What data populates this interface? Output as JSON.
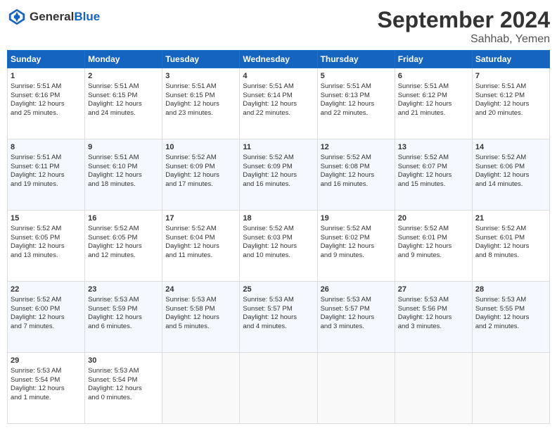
{
  "header": {
    "logo_text_general": "General",
    "logo_text_blue": "Blue",
    "month_title": "September 2024",
    "location": "Sahhab, Yemen"
  },
  "weekdays": [
    "Sunday",
    "Monday",
    "Tuesday",
    "Wednesday",
    "Thursday",
    "Friday",
    "Saturday"
  ],
  "weeks": [
    [
      {
        "day": "1",
        "lines": [
          "Sunrise: 5:51 AM",
          "Sunset: 6:16 PM",
          "Daylight: 12 hours",
          "and 25 minutes."
        ]
      },
      {
        "day": "2",
        "lines": [
          "Sunrise: 5:51 AM",
          "Sunset: 6:15 PM",
          "Daylight: 12 hours",
          "and 24 minutes."
        ]
      },
      {
        "day": "3",
        "lines": [
          "Sunrise: 5:51 AM",
          "Sunset: 6:15 PM",
          "Daylight: 12 hours",
          "and 23 minutes."
        ]
      },
      {
        "day": "4",
        "lines": [
          "Sunrise: 5:51 AM",
          "Sunset: 6:14 PM",
          "Daylight: 12 hours",
          "and 22 minutes."
        ]
      },
      {
        "day": "5",
        "lines": [
          "Sunrise: 5:51 AM",
          "Sunset: 6:13 PM",
          "Daylight: 12 hours",
          "and 22 minutes."
        ]
      },
      {
        "day": "6",
        "lines": [
          "Sunrise: 5:51 AM",
          "Sunset: 6:12 PM",
          "Daylight: 12 hours",
          "and 21 minutes."
        ]
      },
      {
        "day": "7",
        "lines": [
          "Sunrise: 5:51 AM",
          "Sunset: 6:12 PM",
          "Daylight: 12 hours",
          "and 20 minutes."
        ]
      }
    ],
    [
      {
        "day": "8",
        "lines": [
          "Sunrise: 5:51 AM",
          "Sunset: 6:11 PM",
          "Daylight: 12 hours",
          "and 19 minutes."
        ]
      },
      {
        "day": "9",
        "lines": [
          "Sunrise: 5:51 AM",
          "Sunset: 6:10 PM",
          "Daylight: 12 hours",
          "and 18 minutes."
        ]
      },
      {
        "day": "10",
        "lines": [
          "Sunrise: 5:52 AM",
          "Sunset: 6:09 PM",
          "Daylight: 12 hours",
          "and 17 minutes."
        ]
      },
      {
        "day": "11",
        "lines": [
          "Sunrise: 5:52 AM",
          "Sunset: 6:09 PM",
          "Daylight: 12 hours",
          "and 16 minutes."
        ]
      },
      {
        "day": "12",
        "lines": [
          "Sunrise: 5:52 AM",
          "Sunset: 6:08 PM",
          "Daylight: 12 hours",
          "and 16 minutes."
        ]
      },
      {
        "day": "13",
        "lines": [
          "Sunrise: 5:52 AM",
          "Sunset: 6:07 PM",
          "Daylight: 12 hours",
          "and 15 minutes."
        ]
      },
      {
        "day": "14",
        "lines": [
          "Sunrise: 5:52 AM",
          "Sunset: 6:06 PM",
          "Daylight: 12 hours",
          "and 14 minutes."
        ]
      }
    ],
    [
      {
        "day": "15",
        "lines": [
          "Sunrise: 5:52 AM",
          "Sunset: 6:05 PM",
          "Daylight: 12 hours",
          "and 13 minutes."
        ]
      },
      {
        "day": "16",
        "lines": [
          "Sunrise: 5:52 AM",
          "Sunset: 6:05 PM",
          "Daylight: 12 hours",
          "and 12 minutes."
        ]
      },
      {
        "day": "17",
        "lines": [
          "Sunrise: 5:52 AM",
          "Sunset: 6:04 PM",
          "Daylight: 12 hours",
          "and 11 minutes."
        ]
      },
      {
        "day": "18",
        "lines": [
          "Sunrise: 5:52 AM",
          "Sunset: 6:03 PM",
          "Daylight: 12 hours",
          "and 10 minutes."
        ]
      },
      {
        "day": "19",
        "lines": [
          "Sunrise: 5:52 AM",
          "Sunset: 6:02 PM",
          "Daylight: 12 hours",
          "and 9 minutes."
        ]
      },
      {
        "day": "20",
        "lines": [
          "Sunrise: 5:52 AM",
          "Sunset: 6:01 PM",
          "Daylight: 12 hours",
          "and 9 minutes."
        ]
      },
      {
        "day": "21",
        "lines": [
          "Sunrise: 5:52 AM",
          "Sunset: 6:01 PM",
          "Daylight: 12 hours",
          "and 8 minutes."
        ]
      }
    ],
    [
      {
        "day": "22",
        "lines": [
          "Sunrise: 5:52 AM",
          "Sunset: 6:00 PM",
          "Daylight: 12 hours",
          "and 7 minutes."
        ]
      },
      {
        "day": "23",
        "lines": [
          "Sunrise: 5:53 AM",
          "Sunset: 5:59 PM",
          "Daylight: 12 hours",
          "and 6 minutes."
        ]
      },
      {
        "day": "24",
        "lines": [
          "Sunrise: 5:53 AM",
          "Sunset: 5:58 PM",
          "Daylight: 12 hours",
          "and 5 minutes."
        ]
      },
      {
        "day": "25",
        "lines": [
          "Sunrise: 5:53 AM",
          "Sunset: 5:57 PM",
          "Daylight: 12 hours",
          "and 4 minutes."
        ]
      },
      {
        "day": "26",
        "lines": [
          "Sunrise: 5:53 AM",
          "Sunset: 5:57 PM",
          "Daylight: 12 hours",
          "and 3 minutes."
        ]
      },
      {
        "day": "27",
        "lines": [
          "Sunrise: 5:53 AM",
          "Sunset: 5:56 PM",
          "Daylight: 12 hours",
          "and 3 minutes."
        ]
      },
      {
        "day": "28",
        "lines": [
          "Sunrise: 5:53 AM",
          "Sunset: 5:55 PM",
          "Daylight: 12 hours",
          "and 2 minutes."
        ]
      }
    ],
    [
      {
        "day": "29",
        "lines": [
          "Sunrise: 5:53 AM",
          "Sunset: 5:54 PM",
          "Daylight: 12 hours",
          "and 1 minute."
        ]
      },
      {
        "day": "30",
        "lines": [
          "Sunrise: 5:53 AM",
          "Sunset: 5:54 PM",
          "Daylight: 12 hours",
          "and 0 minutes."
        ]
      },
      {
        "day": "",
        "lines": []
      },
      {
        "day": "",
        "lines": []
      },
      {
        "day": "",
        "lines": []
      },
      {
        "day": "",
        "lines": []
      },
      {
        "day": "",
        "lines": []
      }
    ]
  ]
}
